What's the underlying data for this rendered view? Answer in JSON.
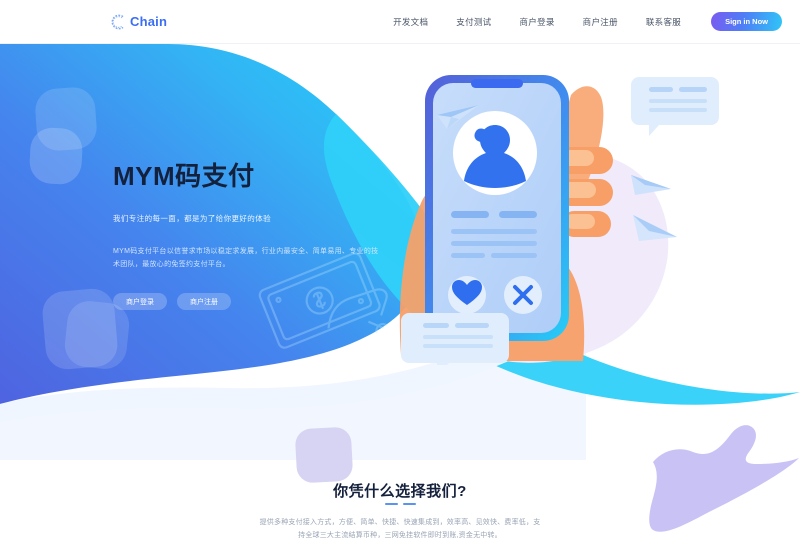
{
  "brand": {
    "name": "Chain",
    "logo_icon": "chain-c-logo-icon",
    "color": "#3b6ef5"
  },
  "nav": {
    "links": [
      {
        "label": "开发文档",
        "name": "dev-docs"
      },
      {
        "label": "支付测试",
        "name": "payment-test"
      },
      {
        "label": "商户登录",
        "name": "merchant-login"
      },
      {
        "label": "商户注册",
        "name": "merchant-register"
      },
      {
        "label": "联系客服",
        "name": "contact-support"
      }
    ],
    "signin_label": "Sign in Now"
  },
  "hero": {
    "title": "MYM码支付",
    "subtitle": "我们专注的每一面，都是为了给你更好的体验",
    "description": "MYM码支付平台以信誉求市场以稳定求发展，行业内最安全、简单易用、专业的技术团队，最放心的免签约支付平台。",
    "buttons": [
      {
        "label": "商户登录",
        "name": "hero-merchant-login"
      },
      {
        "label": "商户注册",
        "name": "hero-merchant-register"
      }
    ],
    "gradient_from": "#4f63e0",
    "gradient_to": "#22c9f5"
  },
  "illustration": {
    "alt": "hand-holding-phone-illustration",
    "heart_icon": "heart-icon",
    "close_icon": "close-x-icon",
    "avatar_icon": "person-avatar-icon",
    "paper_plane_icon": "paper-plane-icon",
    "chat_bubble_icon": "chat-bubble-icon"
  },
  "features": {
    "title": "你凭什么选择我们?",
    "description": "提供多种支付接入方式，方便、简单、快捷、快速集成到，效率高、见效快、费率低，支持全球三大主流结算币种，三网免挂软件即时到账,资金无中转。",
    "divider_color": "#5b93f0"
  }
}
